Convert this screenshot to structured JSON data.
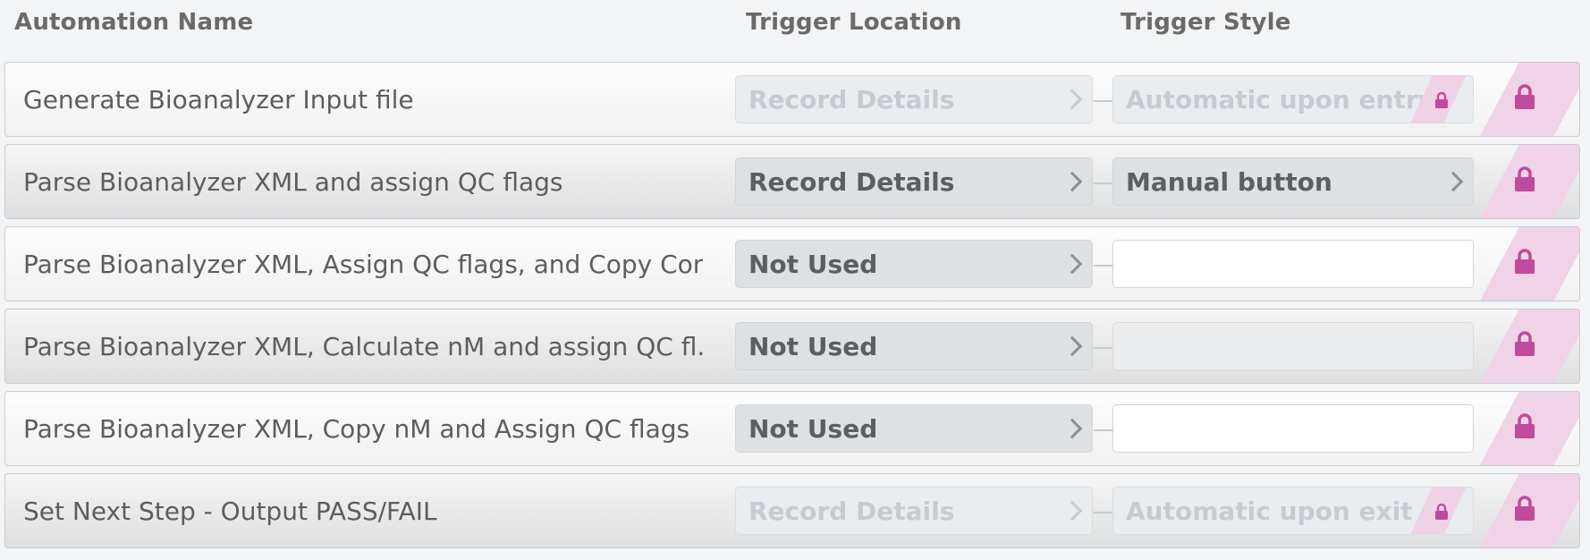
{
  "header": {
    "automation_name": "Automation Name",
    "trigger_location": "Trigger Location",
    "trigger_style": "Trigger Style"
  },
  "colors": {
    "lock": "#c04a9b",
    "lock_stripe": "#f0d3e6",
    "header_text": "#6a6a6a"
  },
  "icons": {
    "lock": "lock-icon",
    "chevron": "chevron-right-icon"
  },
  "rows": [
    {
      "name": "Generate Bioanalyzer Input file",
      "trigger_location": "Record Details",
      "trigger_style": "Automatic upon entry"
    },
    {
      "name": "Parse Bioanalyzer XML and assign QC flags",
      "trigger_location": "Record Details",
      "trigger_style": "Manual button"
    },
    {
      "name": "Parse Bioanalyzer XML, Assign QC flags, and Copy Con...",
      "trigger_location": "Not Used",
      "trigger_style": ""
    },
    {
      "name": "Parse Bioanalyzer XML, Calculate nM and assign QC fl...",
      "trigger_location": "Not Used",
      "trigger_style": ""
    },
    {
      "name": "Parse Bioanalyzer XML, Copy nM and Assign QC flags",
      "trigger_location": "Not Used",
      "trigger_style": ""
    },
    {
      "name": "Set Next Step - Output PASS/FAIL",
      "trigger_location": "Record Details",
      "trigger_style": "Automatic upon exit"
    }
  ]
}
